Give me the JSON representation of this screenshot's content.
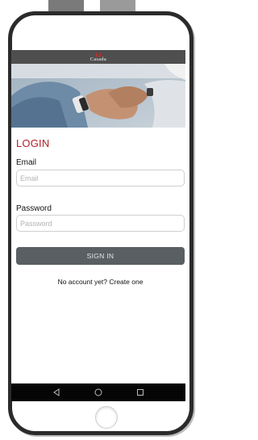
{
  "app": {
    "brand_name": "Casada"
  },
  "login": {
    "title": "LOGIN",
    "email_label": "Email",
    "email_placeholder": "Email",
    "password_label": "Password",
    "password_placeholder": "Password",
    "signin_label": "SIGN IN",
    "signup_text": "No account yet? Create one"
  },
  "navbar": {
    "icons": [
      "back-icon",
      "home-icon",
      "recents-icon"
    ]
  },
  "colors": {
    "accent": "#b22028",
    "brand_bar": "#4f4f4f",
    "button": "#595f63",
    "navbar": "#050505"
  }
}
